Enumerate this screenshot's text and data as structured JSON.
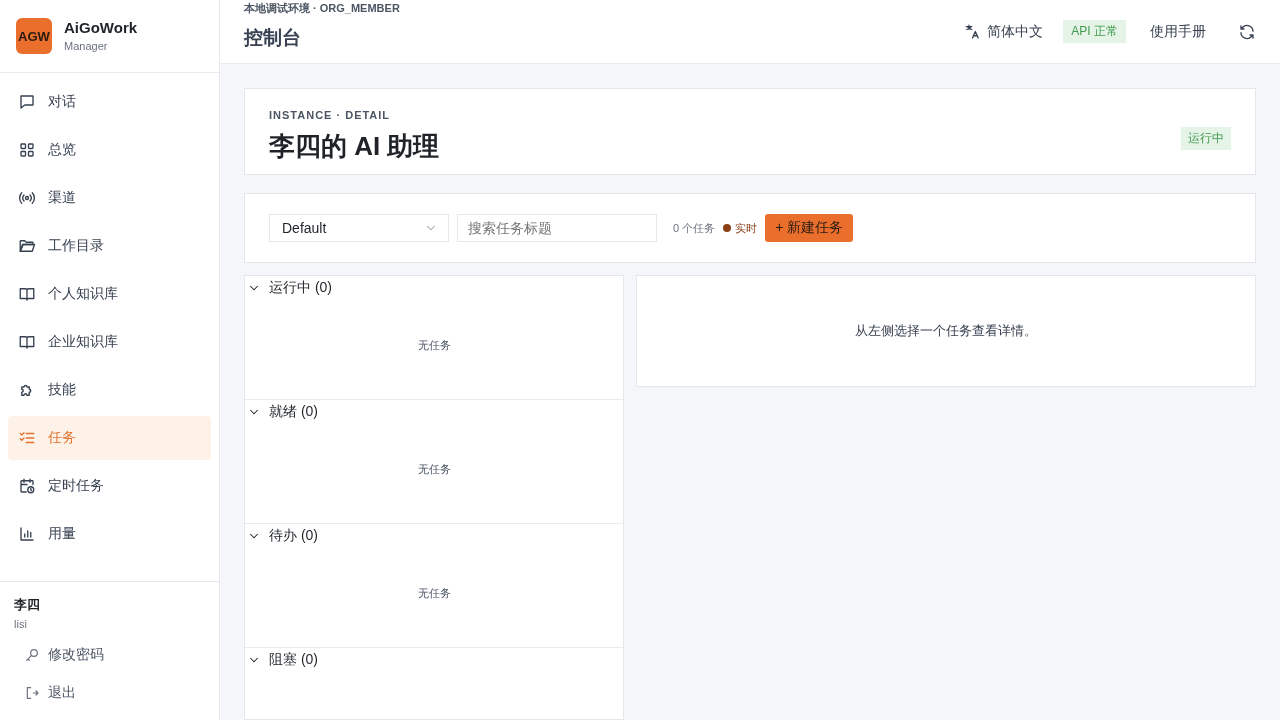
{
  "brand": {
    "logo": "AGW",
    "name": "AiGoWork",
    "subtitle": "Manager"
  },
  "nav": [
    {
      "label": "对话",
      "selected": false
    },
    {
      "label": "总览",
      "selected": false
    },
    {
      "label": "渠道",
      "selected": false
    },
    {
      "label": "工作目录",
      "selected": false
    },
    {
      "label": "个人知识库",
      "selected": false
    },
    {
      "label": "企业知识库",
      "selected": false
    },
    {
      "label": "技能",
      "selected": false
    },
    {
      "label": "任务",
      "selected": true
    },
    {
      "label": "定时任务",
      "selected": false
    },
    {
      "label": "用量",
      "selected": false
    }
  ],
  "user": {
    "name": "李四",
    "login": "lisi",
    "actions": [
      "修改密码",
      "退出"
    ]
  },
  "header": {
    "context": "本地调试环境 · ORG_MEMBER",
    "title": "控制台",
    "language": "简体中文",
    "api_status": "API 正常",
    "manual": "使用手册"
  },
  "instance": {
    "eyebrow": "INSTANCE · DETAIL",
    "title": "李四的 AI 助理",
    "status": "运行中"
  },
  "toolbar": {
    "board": "Default",
    "search_placeholder": "搜索任务标题",
    "count": "0 个任务",
    "live": "实时",
    "new_button": "+ 新建任务"
  },
  "groups": [
    {
      "title": "运行中 (0)",
      "expanded": true,
      "empty": "无任务"
    },
    {
      "title": "就绪 (0)",
      "expanded": true,
      "empty": "无任务"
    },
    {
      "title": "待办 (0)",
      "expanded": true,
      "empty": "无任务"
    },
    {
      "title": "阻塞 (0)",
      "expanded": true
    }
  ],
  "detail": {
    "message": "从左侧选择一个任务查看详情。"
  }
}
